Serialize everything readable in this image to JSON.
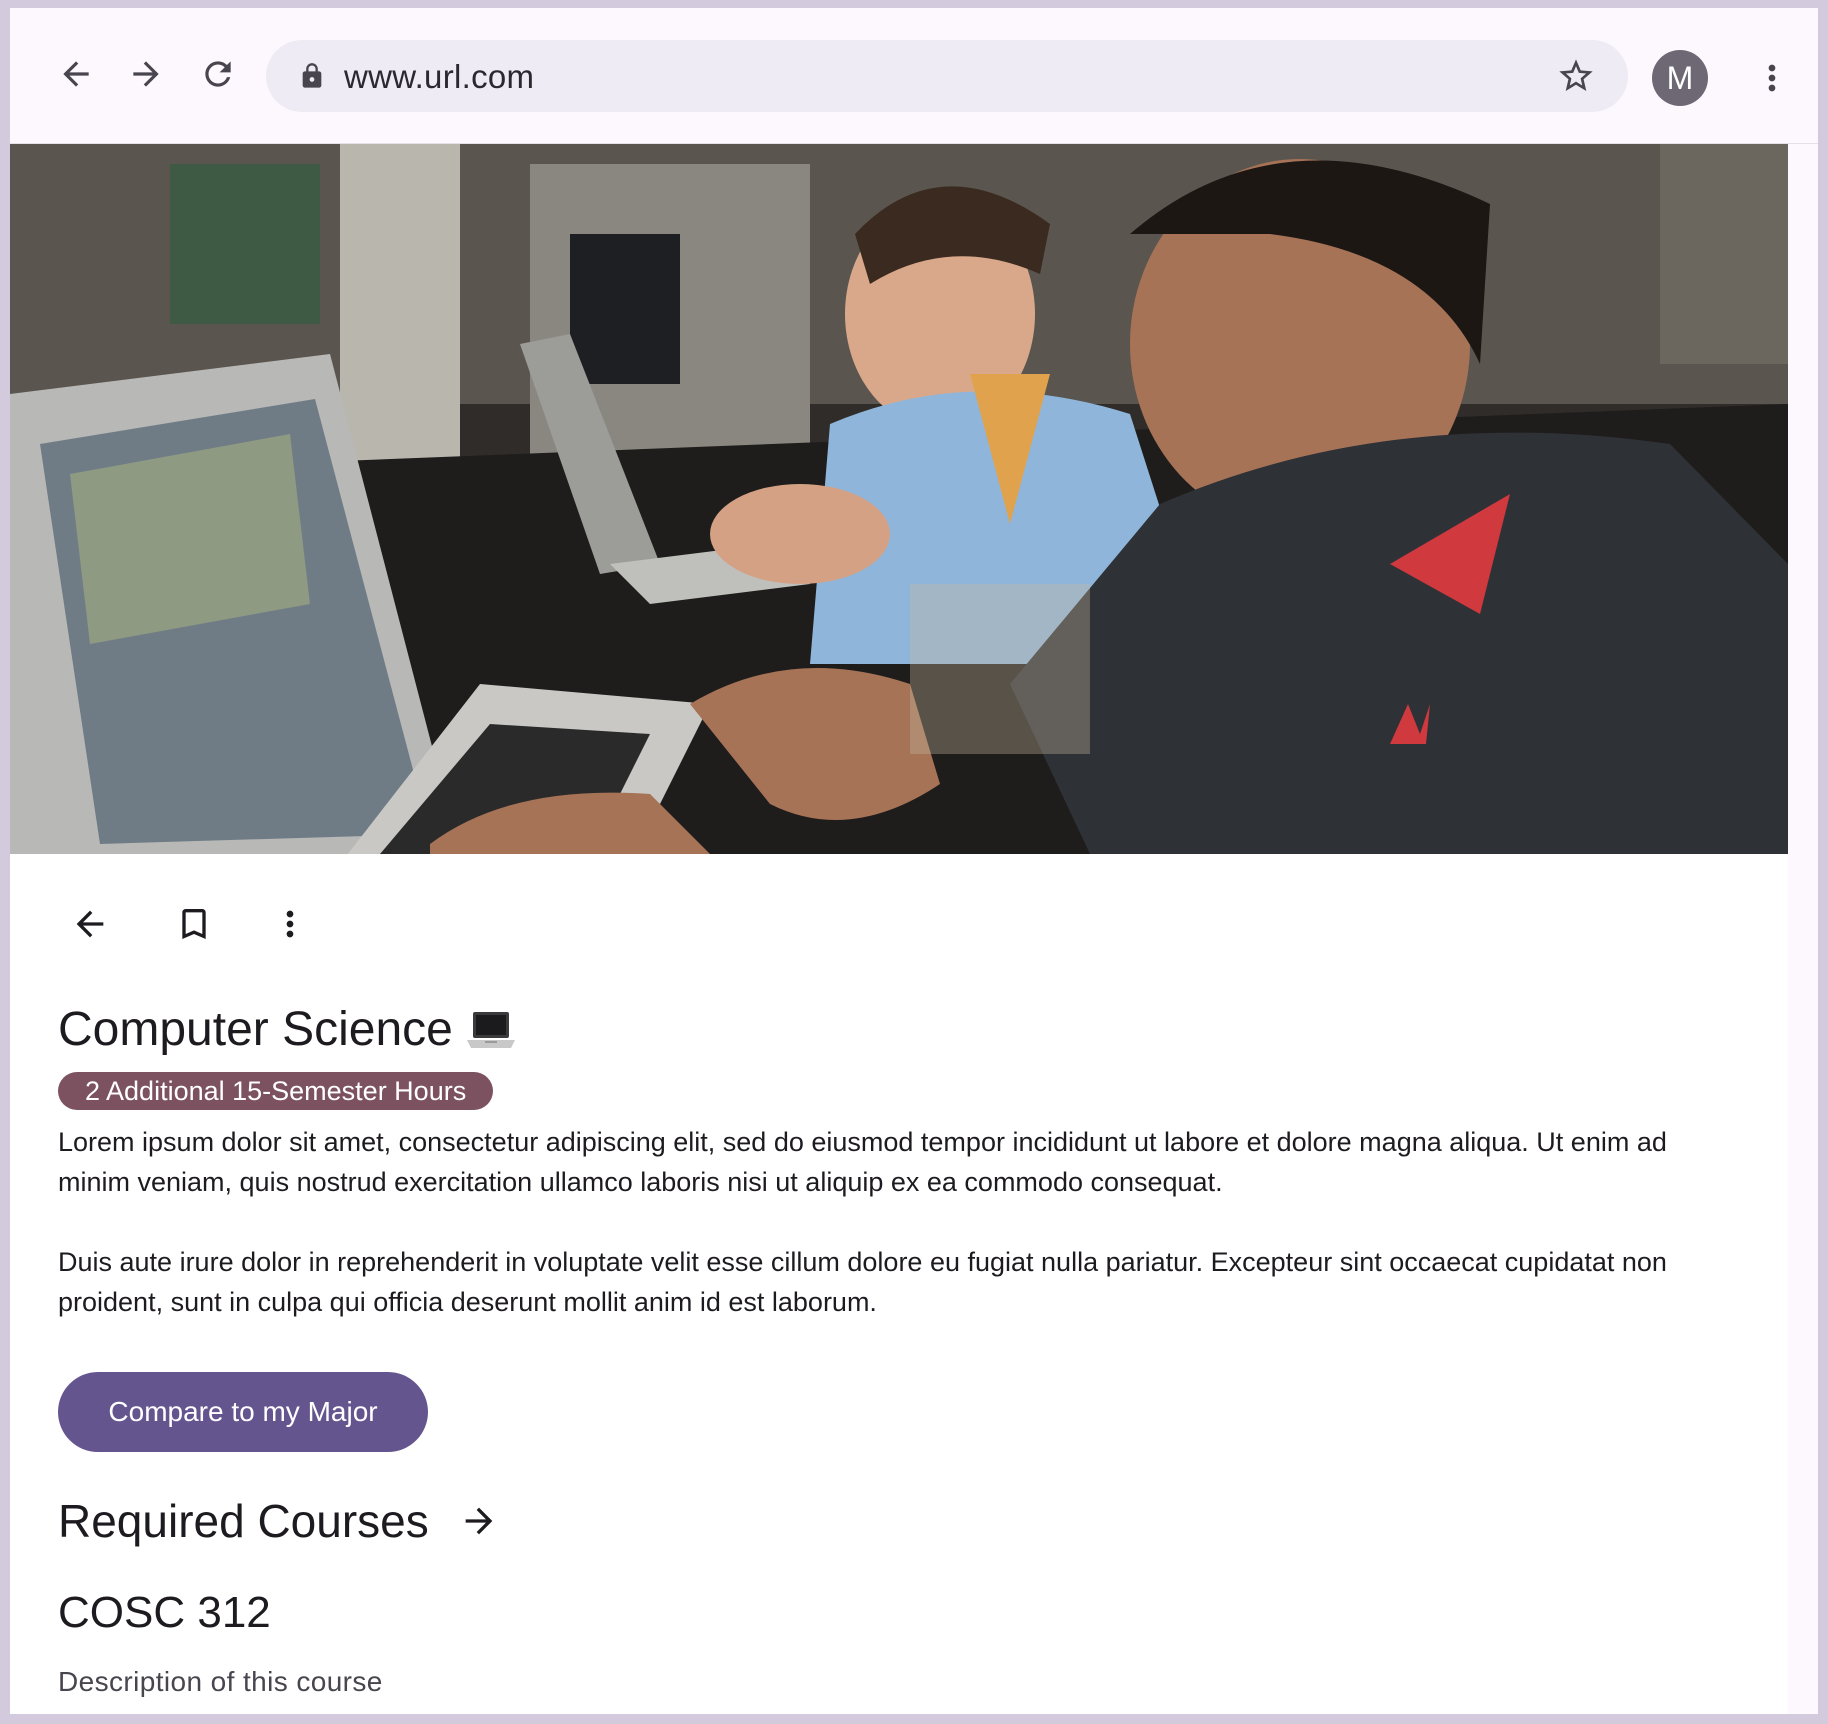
{
  "browser": {
    "url": "www.url.com",
    "profile_initial": "M",
    "icons": [
      "back-arrow-icon",
      "forward-arrow-icon",
      "reload-icon",
      "lock-icon",
      "star-icon",
      "more-vert-icon"
    ]
  },
  "hero": {
    "image_description": "Students working on laptops in a computer lab"
  },
  "toolbar": {
    "icons": [
      "back-arrow-icon",
      "bookmark-icon",
      "more-vert-icon"
    ]
  },
  "program": {
    "title": "Computer Science",
    "emoji_icon": "laptop-icon",
    "badge": "2 Additional 15-Semester Hours",
    "paragraph_1": "Lorem ipsum dolor sit amet, consectetur adipiscing elit, sed do eiusmod tempor incididunt ut labore et dolore magna aliqua. Ut enim ad minim veniam, quis nostrud exercitation ullamco laboris nisi ut aliquip ex ea commodo consequat.",
    "paragraph_2": "Duis aute irure dolor in reprehenderit in voluptate velit esse cillum dolore eu fugiat nulla pariatur. Excepteur sint occaecat cupidatat non proident, sunt in culpa qui officia deserunt mollit anim id est laborum.",
    "cta_label": "Compare to my Major"
  },
  "required_courses": {
    "heading": "Required Courses",
    "courses": [
      {
        "code": "COSC 312",
        "description": "Description of this course"
      }
    ]
  },
  "colors": {
    "badge_bg": "#7d5260",
    "cta_bg": "#65558f",
    "url_bar_bg": "#efebf4",
    "window_border": "#d3cbdd"
  }
}
